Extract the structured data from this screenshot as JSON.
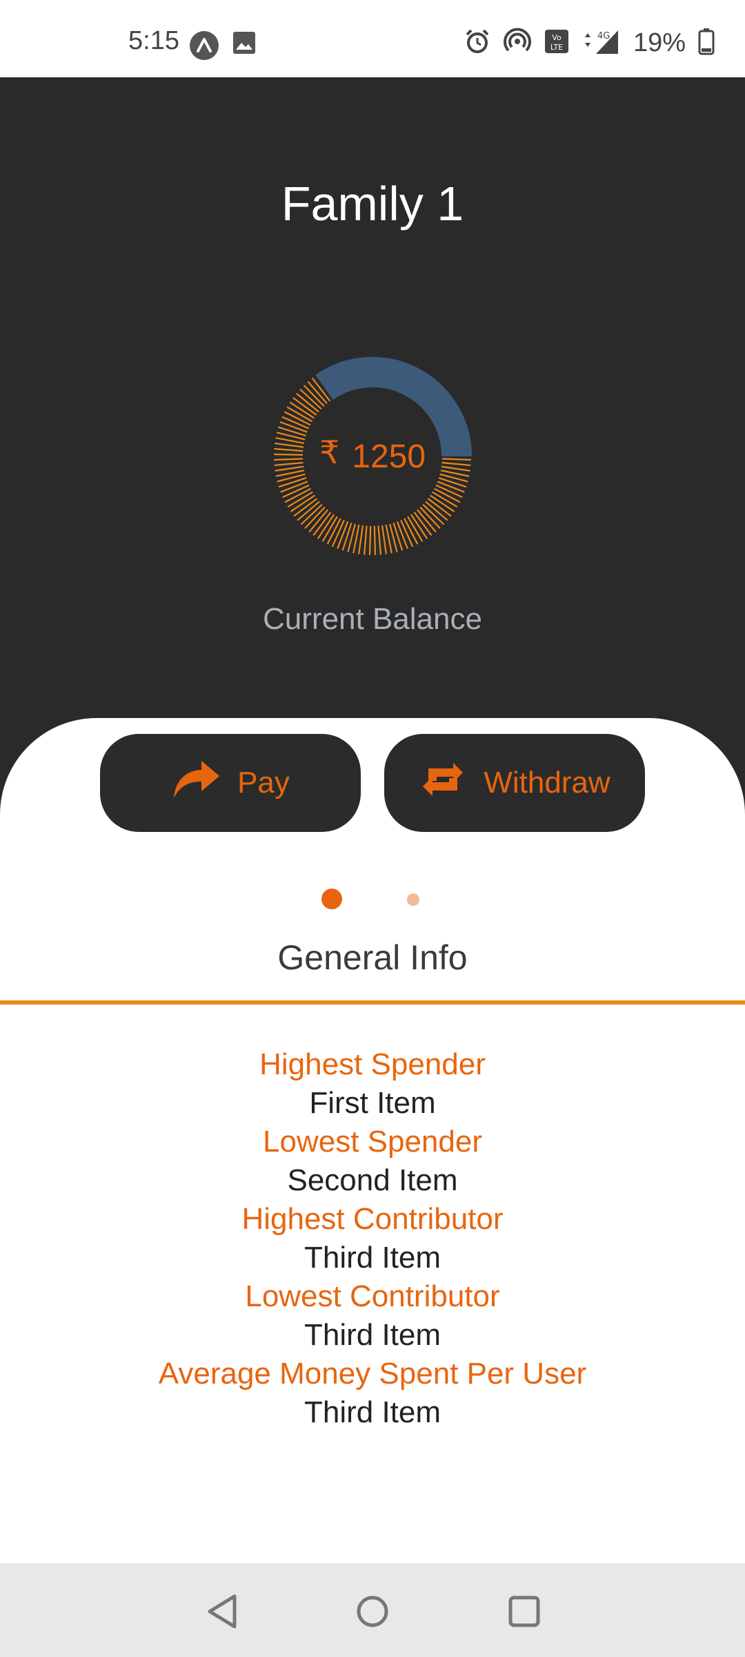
{
  "status_bar": {
    "time": "5:15",
    "battery": "19%",
    "left_icons": [
      "app-notification-icon",
      "image-icon"
    ],
    "right_icons": [
      "alarm-icon",
      "hotspot-icon",
      "volte-icon",
      "signal-4g-icon",
      "battery-icon"
    ]
  },
  "header": {
    "title": "Family 1",
    "currency_symbol": "₹",
    "balance": "1250",
    "balance_label": "Current Balance"
  },
  "actions": {
    "pay_label": "Pay",
    "withdraw_label": "Withdraw"
  },
  "pager": {
    "pages": 2,
    "active_index": 0
  },
  "section": {
    "title": "General Info"
  },
  "info": [
    {
      "label": "Highest Spender",
      "value": "First Item"
    },
    {
      "label": "Lowest Spender",
      "value": "Second Item"
    },
    {
      "label": "Highest Contributor",
      "value": "Third Item"
    },
    {
      "label": "Lowest Contributor",
      "value": "Third Item"
    },
    {
      "label": "Average Money Spent Per User",
      "value": "Third Item"
    }
  ],
  "colors": {
    "accent": "#e8650f",
    "header_bg": "#2a2a2a",
    "ring_blue": "#3d5a7a",
    "ring_orange": "#e9891c"
  }
}
